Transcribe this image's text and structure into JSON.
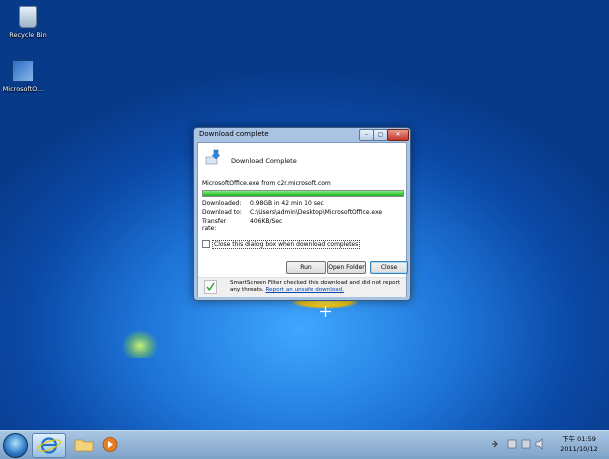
{
  "desktop": {
    "icons": [
      {
        "label": "Recycle Bin",
        "icon": "recycle-bin-icon"
      },
      {
        "label": "MicrosoftO...",
        "icon": "installer-icon"
      }
    ]
  },
  "dialog": {
    "title": "Download complete",
    "heading": "Download Complete",
    "source": "MicrosoftOffice.exe from c2r.microsoft.com",
    "progress": 1.0,
    "rows": [
      {
        "label": "Downloaded:",
        "value": "0.98GB in 42 min 10 sec"
      },
      {
        "label": "Download to:",
        "value": "C:\\Users\\admin\\Desktop\\MicrosoftOffice.exe"
      },
      {
        "label": "Transfer rate:",
        "value": "406KB/Sec"
      }
    ],
    "checkbox_label": "Close this dialog box when download completes",
    "buttons": {
      "run": "Run",
      "open_folder": "Open Folder",
      "close": "Close"
    },
    "smartscreen_text": "SmartScreen Filter checked this download and did not report any threats.",
    "smartscreen_link": "Report an unsafe download.",
    "window_buttons": {
      "minimize": "–",
      "maximize": "▢",
      "close": "✕"
    }
  },
  "taskbar": {
    "apps": [
      "internet-explorer-icon",
      "folder-icon",
      "media-player-icon"
    ],
    "clock_line1": "下午 01:59",
    "clock_line2": "2011/10/12"
  },
  "colors": {
    "progress_fill": "#19b219",
    "close_button": "#c0392b",
    "link": "#0645ad"
  }
}
